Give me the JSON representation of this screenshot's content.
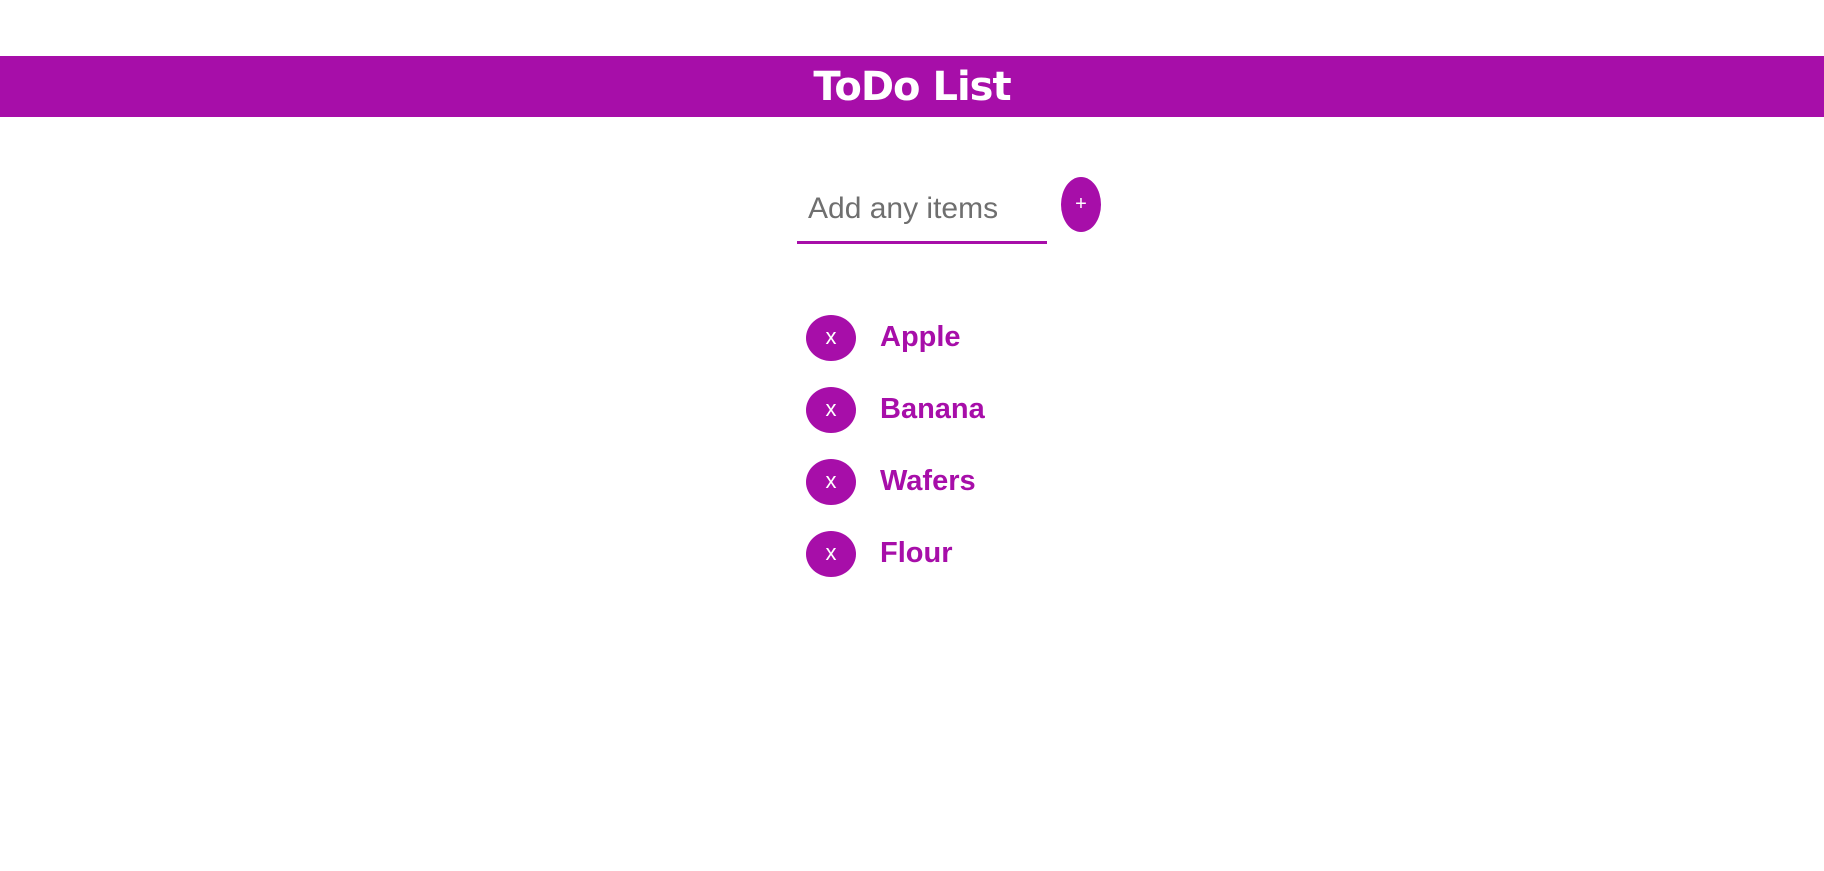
{
  "app": {
    "title": "ToDo List"
  },
  "input": {
    "placeholder": "Add any items",
    "value": "",
    "add_label": "+"
  },
  "items": [
    {
      "label": "Apple",
      "delete_label": "x"
    },
    {
      "label": "Banana",
      "delete_label": "x"
    },
    {
      "label": "Wafers",
      "delete_label": "x"
    },
    {
      "label": "Flour",
      "delete_label": "x"
    }
  ],
  "colors": {
    "accent": "#a70ea9",
    "background": "#ffffff",
    "text_on_accent": "#ffffff",
    "placeholder": "#6f6f6f"
  },
  "icons": {
    "add": "plus-icon",
    "delete": "close-icon"
  }
}
